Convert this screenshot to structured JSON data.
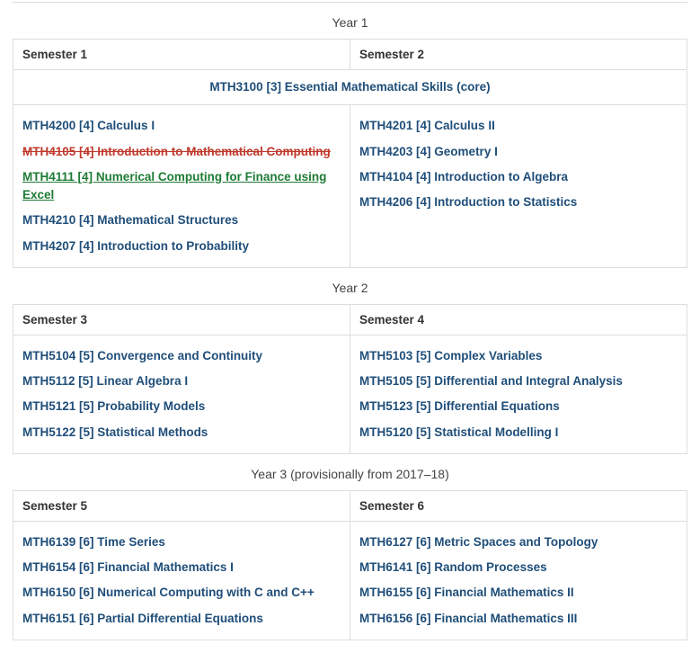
{
  "year1": {
    "caption": "Year 1",
    "sem_left": "Semester 1",
    "sem_right": "Semester 2",
    "core": {
      "code": "MTH3100",
      "level": "[3]",
      "title": "Essential Mathematical Skills (core)"
    },
    "left": [
      {
        "code": "MTH4200",
        "level": "[4]",
        "title": "Calculus I",
        "style": ""
      },
      {
        "code": "MTH4105",
        "level": "[4]",
        "title": "Introduction to Mathematical Computing",
        "style": "strike"
      },
      {
        "code": "MTH4111",
        "level": "[4]",
        "title": "Numerical Computing for Finance using Excel",
        "style": "added"
      },
      {
        "code": "MTH4210",
        "level": "[4]",
        "title": "Mathematical Structures",
        "style": ""
      },
      {
        "code": "MTH4207",
        "level": "[4]",
        "title": "Introduction to Probability",
        "style": ""
      }
    ],
    "right": [
      {
        "code": "MTH4201",
        "level": "[4]",
        "title": "Calculus II"
      },
      {
        "code": "MTH4203",
        "level": "[4]",
        "title": "Geometry I"
      },
      {
        "code": "MTH4104",
        "level": "[4]",
        "title": "Introduction to Algebra"
      },
      {
        "code": "MTH4206",
        "level": "[4]",
        "title": "Introduction to Statistics"
      }
    ]
  },
  "year2": {
    "caption": "Year 2",
    "sem_left": "Semester 3",
    "sem_right": "Semester 4",
    "left": [
      {
        "code": "MTH5104",
        "level": "[5]",
        "title": "Convergence and Continuity"
      },
      {
        "code": "MTH5112",
        "level": "[5]",
        "title": "Linear Algebra I"
      },
      {
        "code": "MTH5121",
        "level": "[5]",
        "title": "Probability Models"
      },
      {
        "code": "MTH5122",
        "level": "[5]",
        "title": "Statistical Methods"
      }
    ],
    "right": [
      {
        "code": "MTH5103",
        "level": "[5]",
        "title": "Complex Variables"
      },
      {
        "code": "MTH5105",
        "level": "[5]",
        "title": "Differential and Integral Analysis"
      },
      {
        "code": "MTH5123",
        "level": "[5]",
        "title": "Differential Equations"
      },
      {
        "code": "MTH5120",
        "level": "[5]",
        "title": "Statistical Modelling I"
      }
    ]
  },
  "year3": {
    "caption": "Year 3 (provisionally from 2017–18)",
    "sem_left": "Semester 5",
    "sem_right": "Semester 6",
    "left": [
      {
        "code": "MTH6139",
        "level": "[6]",
        "title": "Time Series"
      },
      {
        "code": "MTH6154",
        "level": "[6]",
        "title": "Financial Mathematics I"
      },
      {
        "code": "MTH6150",
        "level": "[6]",
        "title": "Numerical Computing with C and C++"
      },
      {
        "code": "MTH6151",
        "level": "[6]",
        "title": "Partial Differential Equations"
      }
    ],
    "right": [
      {
        "code": "MTH6127",
        "level": "[6]",
        "title": "Metric Spaces and Topology"
      },
      {
        "code": "MTH6141",
        "level": "[6]",
        "title": "Random Processes"
      },
      {
        "code": "MTH6155",
        "level": "[6]",
        "title": "Financial Mathematics II"
      },
      {
        "code": "MTH6156",
        "level": "[6]",
        "title": "Financial Mathematics III"
      }
    ]
  }
}
